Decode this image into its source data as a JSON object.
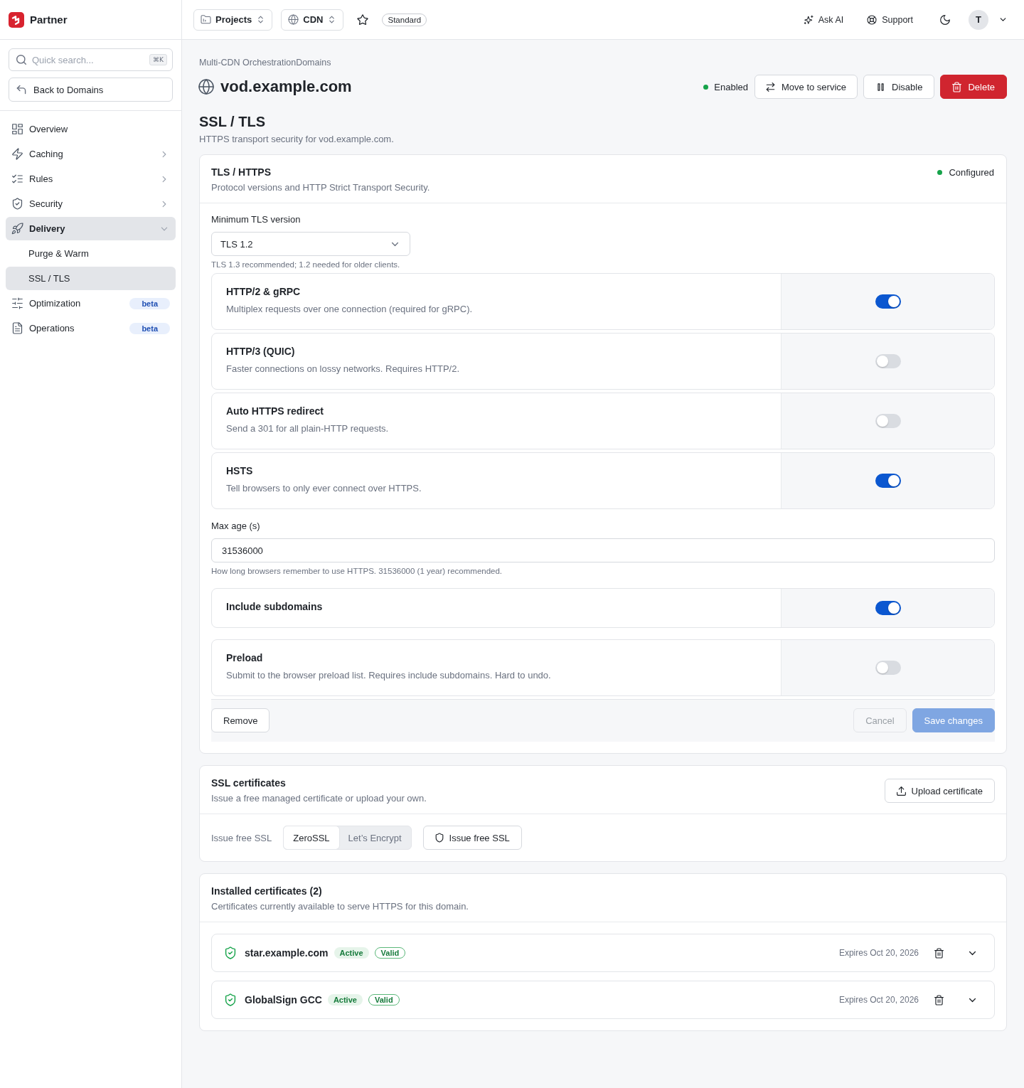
{
  "app": {
    "name": "Partner"
  },
  "sidebar": {
    "search": {
      "placeholder": "Quick search...",
      "shortcut": "⌘K"
    },
    "back_button": "Back to Domains",
    "nav": [
      {
        "label": "Overview",
        "selected": false
      },
      {
        "label": "Caching",
        "selected": false,
        "expanded": false
      },
      {
        "label": "Rules",
        "selected": false,
        "expanded": false
      },
      {
        "label": "Security",
        "selected": false,
        "expanded": false
      },
      {
        "label": "Delivery",
        "selected": true,
        "expanded": true,
        "children": [
          {
            "label": "Purge & Warm",
            "selected": false
          },
          {
            "label": "SSL / TLS",
            "selected": true
          }
        ]
      },
      {
        "label": "Optimization",
        "selected": false,
        "badge": "beta"
      },
      {
        "label": "Operations",
        "selected": false,
        "badge": "beta"
      }
    ]
  },
  "topbar": {
    "project_selector": "Projects",
    "service_selector": "CDN",
    "starred": false,
    "plan": "Standard",
    "ask_ai": "Ask AI",
    "support": "Support",
    "user_initial": "T"
  },
  "header": {
    "breadcrumb": "Multi-CDN OrchestrationDomains",
    "title": "vod.example.com",
    "status": "Enabled",
    "actions": [
      {
        "kind": "move",
        "label": "Move to service"
      },
      {
        "kind": "pause",
        "label": "Disable"
      },
      {
        "kind": "delete",
        "label": "Delete"
      }
    ]
  },
  "section": {
    "title": "SSL / TLS",
    "subtitle": "HTTPS transport security for vod.example.com."
  },
  "tls_card": {
    "title": "TLS / HTTPS",
    "description": "Protocol versions and HTTP Strict Transport Security.",
    "status": "Configured",
    "fields": [
      {
        "kind": "select",
        "label": "Minimum TLS version",
        "value": "TLS 1.2",
        "hint": "TLS 1.3 recommended; 1.2 needed for older clients."
      },
      {
        "kind": "toggle",
        "label": "HTTP/2 & gRPC",
        "description": "Multiplex requests over one connection (required for gRPC).",
        "on": true
      },
      {
        "kind": "toggle",
        "label": "HTTP/3 (QUIC)",
        "description": "Faster connections on lossy networks. Requires HTTP/2.",
        "on": false
      },
      {
        "kind": "toggle",
        "label": "Auto HTTPS redirect",
        "description": "Send a 301 for all plain-HTTP requests.",
        "on": false
      },
      {
        "kind": "toggle",
        "label": "HSTS",
        "description": "Tell browsers to only ever connect over HTTPS.",
        "on": true
      },
      {
        "kind": "input",
        "label": "Max age (s)",
        "value": "31536000",
        "hint": "How long browsers remember to use HTTPS. 31536000 (1 year) recommended."
      },
      {
        "kind": "toggle",
        "label": "Include subdomains",
        "on": true
      },
      {
        "kind": "toggle",
        "label": "Preload",
        "description": "Submit to the browser preload list. Requires include subdomains. Hard to undo.",
        "on": false
      }
    ],
    "footer": {
      "remove": "Remove",
      "cancel": {
        "label": "Cancel",
        "disabled": true
      },
      "save": {
        "label": "Save changes",
        "disabled": true
      }
    }
  },
  "ssl_card": {
    "title": "SSL certificates",
    "description": "Issue a free managed certificate or upload your own.",
    "upload_button": "Upload certificate",
    "issuer_label": "Issue free SSL",
    "issuers": [
      {
        "label": "ZeroSSL",
        "selected": true
      },
      {
        "label": "Let’s Encrypt",
        "selected": false
      }
    ],
    "issue_button": "Issue free SSL"
  },
  "installed_card": {
    "title": "Installed certificates (2)",
    "description": "Certificates currently available to serve HTTPS for this domain.",
    "certificates": [
      {
        "name": "star.example.com",
        "badges": [
          {
            "kind": "status",
            "label": "Active"
          },
          {
            "kind": "validity",
            "label": "Valid"
          }
        ],
        "expires": "Expires Oct 20, 2026"
      },
      {
        "name": "GlobalSign GCC",
        "badges": [
          {
            "kind": "status",
            "label": "Active"
          },
          {
            "kind": "validity",
            "label": "Valid"
          }
        ],
        "expires": "Expires Oct 20, 2026"
      }
    ]
  }
}
